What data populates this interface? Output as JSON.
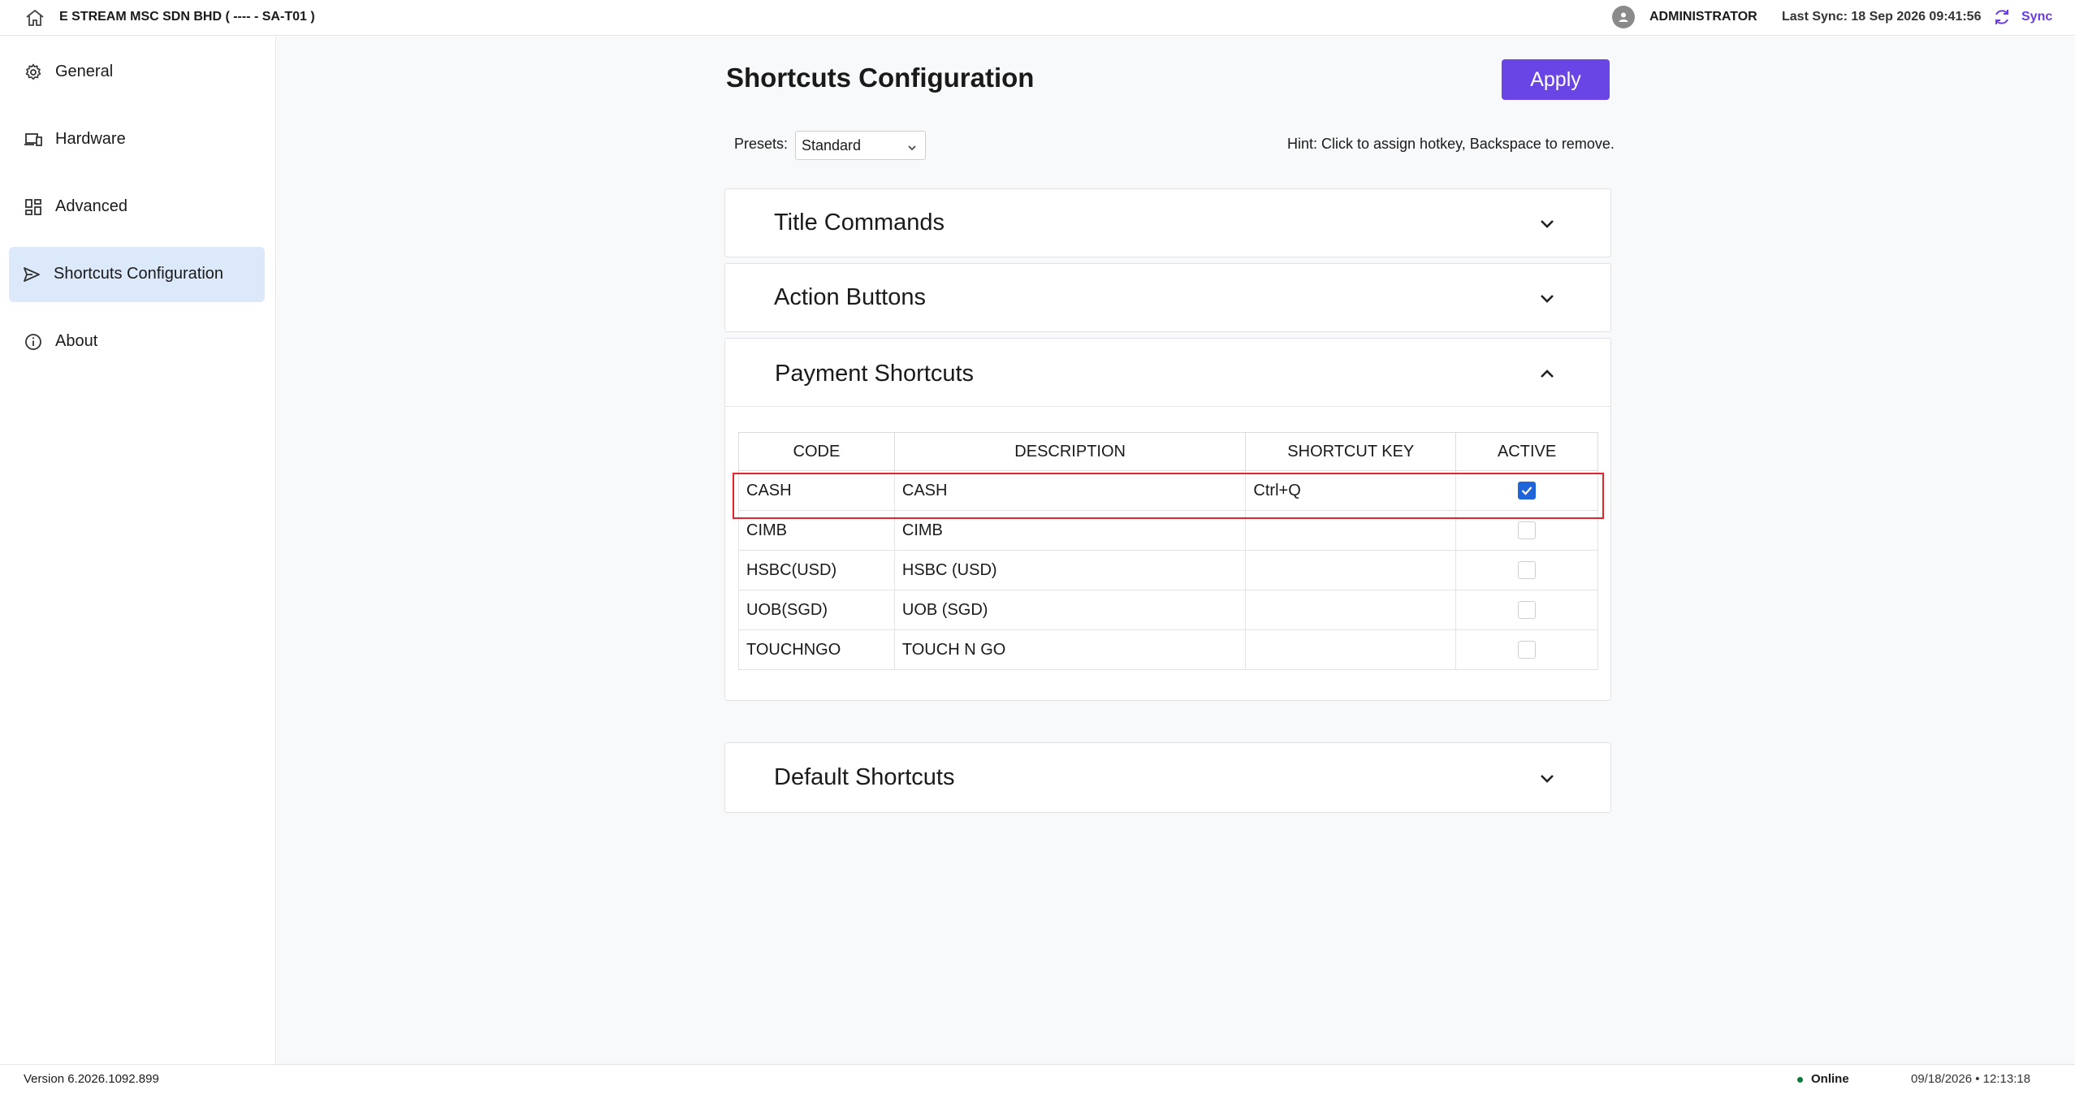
{
  "header": {
    "company": "E STREAM MSC SDN BHD ( ---- - SA-T01 )",
    "user": "ADMINISTRATOR",
    "last_sync": "Last Sync: 18 Sep 2026 09:41:56",
    "sync_label": "Sync"
  },
  "sidebar": {
    "items": [
      {
        "label": "General",
        "icon": "gear-icon"
      },
      {
        "label": "Hardware",
        "icon": "devices-icon"
      },
      {
        "label": "Advanced",
        "icon": "dashboard-icon"
      },
      {
        "label": "Shortcuts Configuration",
        "icon": "send-icon",
        "active": true
      },
      {
        "label": "About",
        "icon": "info-icon"
      }
    ]
  },
  "main": {
    "title": "Shortcuts Configuration",
    "apply_label": "Apply",
    "presets_label": "Presets:",
    "presets_value": "Standard",
    "hint": "Hint: Click to assign hotkey, Backspace to remove.",
    "panels": [
      {
        "title": "Title Commands",
        "expanded": false
      },
      {
        "title": "Action Buttons",
        "expanded": false
      },
      {
        "title": "Payment Shortcuts",
        "expanded": true
      },
      {
        "title": "Default Shortcuts",
        "expanded": false
      }
    ],
    "payment_table": {
      "columns": [
        "CODE",
        "DESCRIPTION",
        "SHORTCUT KEY",
        "ACTIVE"
      ],
      "rows": [
        {
          "code": "CASH",
          "description": "CASH",
          "shortcut": "Ctrl+Q",
          "active": true
        },
        {
          "code": "CIMB",
          "description": "CIMB",
          "shortcut": "",
          "active": false
        },
        {
          "code": "HSBC(USD)",
          "description": "HSBC (USD)",
          "shortcut": "",
          "active": false
        },
        {
          "code": "UOB(SGD)",
          "description": "UOB (SGD)",
          "shortcut": "",
          "active": false
        },
        {
          "code": "TOUCHNGO",
          "description": "TOUCH N GO",
          "shortcut": "",
          "active": false
        }
      ]
    }
  },
  "footer": {
    "version": "Version 6.2026.1092.899",
    "status": "Online",
    "datetime": "09/18/2026  •  12:13:18"
  },
  "colors": {
    "accent": "#6a45e6",
    "active_nav": "#dce9fb",
    "checkbox": "#1f64d8",
    "highlight": "#e0262b",
    "online": "#0a7a3a"
  }
}
